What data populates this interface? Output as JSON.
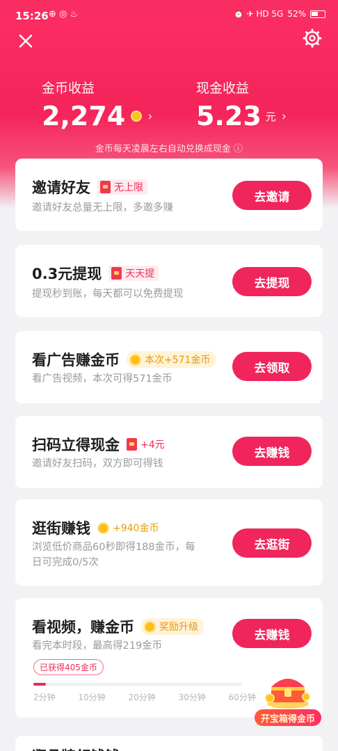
{
  "status_bar": {
    "time": "15:26",
    "left_icons": "⊕ ◎ ♨",
    "right_icons": "⏰ ✈ HD 5G",
    "battery": "52%"
  },
  "header": {
    "close_icon": "close-icon",
    "settings_icon": "gear-icon"
  },
  "earnings": {
    "coin_label": "金币收益",
    "coin_value": "2,274",
    "cash_label": "现金收益",
    "cash_value": "5.23",
    "cash_unit": "元",
    "chevron": "›",
    "note": "金币每天凌晨左右自动兑换成现金 ⓘ"
  },
  "tasks": [
    {
      "title": "邀请好友",
      "tag": "无上限",
      "desc": "邀请好友总量无上限，多邀多赚",
      "button": "去邀请"
    },
    {
      "title": "0.3元提现",
      "tag": "天天提",
      "desc": "提现秒到账，每天都可以免费提现",
      "button": "去提现"
    },
    {
      "title": "看广告赚金币",
      "tag": "本次+571金币",
      "desc": "看广告视频，本次可得571金币",
      "button": "去领取"
    },
    {
      "title": "扫码立得现金",
      "tag": "+4元",
      "desc": "邀请好友扫码，双方即可得钱",
      "button": "去赚钱"
    },
    {
      "title": "逛街赚钱",
      "tag": "+940金币",
      "desc_line1": "浏览低价商品60秒即得188金币，每",
      "desc_line2": "日可完成0/5次",
      "button": "去逛街"
    },
    {
      "title": "看视频，赚金币",
      "tag": "奖励升级",
      "desc": "看完本时段，最高得219金币",
      "button": "去赚钱",
      "progress_badge": "已获得405金币",
      "progress_ratio": 0.06,
      "ticks": [
        "2分钟",
        "10分钟",
        "20分钟",
        "30分钟",
        "60分钟"
      ]
    }
  ],
  "treasure": {
    "label": "开宝箱得金币"
  },
  "next_card": {
    "title": "逛品牌领钱钱"
  },
  "colors": {
    "primary": "#f0255b",
    "gold": "#e59a08",
    "bg": "#f2f2f4"
  }
}
